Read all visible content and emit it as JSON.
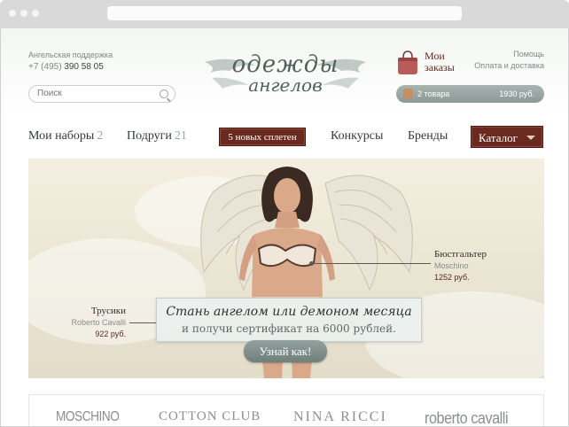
{
  "header": {
    "support_label": "Ангельская поддержка",
    "phone_prefix": "+7 (495)",
    "phone_number": "390 58 05",
    "search_placeholder": "Поиск",
    "logo_line1": "одежды",
    "logo_line2": "ангелов",
    "my_orders": "Мои заказы",
    "help": "Помощь",
    "payment_delivery": "Оплата и доставка",
    "cart_count": "2 товара",
    "cart_sum": "1930 руб."
  },
  "nav": {
    "my_sets": "Мои наборы",
    "my_sets_count": "2",
    "friends": "Подруги",
    "friends_count": "21",
    "new_gossip": "5 новых сплетен",
    "contests": "Конкурсы",
    "brands": "Бренды",
    "catalog": "Каталог"
  },
  "banner": {
    "bra_name": "Бюстгальтер",
    "bra_brand": "Moschino",
    "bra_price": "1252 руб.",
    "panties_name": "Трусики",
    "panties_brand": "Roberto Cavalli",
    "panties_price": "922 руб.",
    "promo_line1": "Стань ангелом или демоном месяца",
    "promo_line2": "и получи сертификат на 6000 рублей.",
    "cta": "Узнай как!"
  },
  "brands": [
    "MOSCHINO",
    "COTTON CLUB",
    "NINA RICCI",
    "roberto cavalli"
  ],
  "colors": {
    "accent": "#6b2a20",
    "muted": "#7c8a86"
  }
}
